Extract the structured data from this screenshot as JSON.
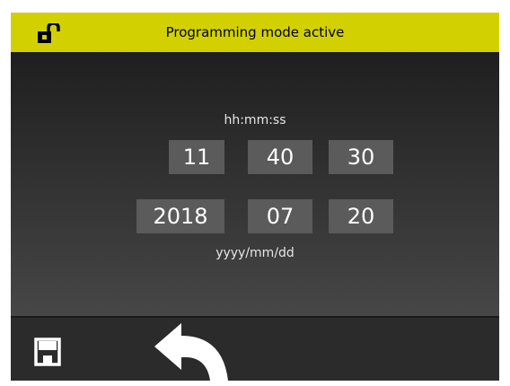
{
  "header": {
    "title": "Programming mode active",
    "lock_icon": "unlocked-padlock-icon",
    "background_color": "#d3d000"
  },
  "time": {
    "format_label": "hh:mm:ss",
    "hours": "11",
    "minutes": "40",
    "seconds": "30"
  },
  "date": {
    "format_label": "yyyy/mm/dd",
    "year": "2018",
    "month": "07",
    "day": "20"
  },
  "footer": {
    "save_icon": "floppy-disk-save-icon",
    "back_icon": "back-arrow-icon"
  }
}
